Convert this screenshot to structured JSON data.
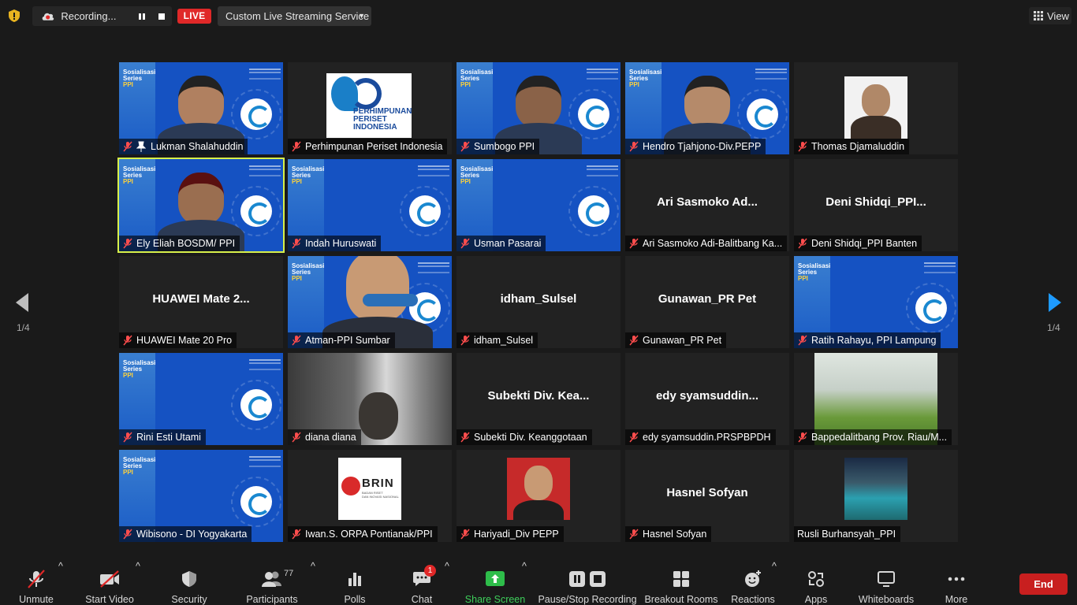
{
  "topbar": {
    "recording_label": "Recording...",
    "live_label": "LIVE",
    "stream_service": "Custom Live Streaming Service",
    "view_label": "View"
  },
  "pagination": {
    "left": "1/4",
    "right": "1/4"
  },
  "slide": {
    "line1": "Sosialisasi",
    "line2": "Series",
    "line3": "PPI"
  },
  "tiles": [
    {
      "label": "Lukman Shalahuddin",
      "big": ""
    },
    {
      "label": "Perhimpunan Periset Indonesia",
      "big": ""
    },
    {
      "label": "Sumbogo PPI",
      "big": ""
    },
    {
      "label": "Hendro Tjahjono-Div.PEPP",
      "big": ""
    },
    {
      "label": "Thomas Djamaluddin",
      "big": ""
    },
    {
      "label": "Ely Eliah BOSDM/ PPI",
      "big": ""
    },
    {
      "label": "Indah Huruswati",
      "big": ""
    },
    {
      "label": "Usman Pasarai",
      "big": ""
    },
    {
      "label": "Ari Sasmoko Adi-Balitbang Ka...",
      "big": "Ari Sasmoko Ad..."
    },
    {
      "label": "Deni Shidqi_PPI Banten",
      "big": "Deni  Shidqi_PPI..."
    },
    {
      "label": "HUAWEI Mate 20 Pro",
      "big": "HUAWEI Mate 2..."
    },
    {
      "label": "Atman-PPI Sumbar",
      "big": ""
    },
    {
      "label": "idham_Sulsel",
      "big": "idham_Sulsel"
    },
    {
      "label": "Gunawan_PR Pet",
      "big": "Gunawan_PR Pet"
    },
    {
      "label": "Ratih Rahayu, PPI Lampung",
      "big": ""
    },
    {
      "label": "Rini Esti Utami",
      "big": ""
    },
    {
      "label": "diana diana",
      "big": ""
    },
    {
      "label": "Subekti Div. Keanggotaan",
      "big": "Subekti  Div.  Kea..."
    },
    {
      "label": "edy syamsuddin.PRSPBPDH",
      "big": "edy  syamsuddin..."
    },
    {
      "label": "Bappedalitbang Prov. Riau/M...",
      "big": ""
    },
    {
      "label": "Wibisono - DI Yogyakarta",
      "big": ""
    },
    {
      "label": "Iwan.S. ORPA Pontianak/PPI",
      "big": ""
    },
    {
      "label": "Hariyadi_Div PEPP",
      "big": ""
    },
    {
      "label": "Hasnel Sofyan",
      "big": "Hasnel Sofyan"
    },
    {
      "label": "Rusli Burhansyah_PPI",
      "big": ""
    }
  ],
  "logo": {
    "ppi_line1": "PERHIMPUNAN",
    "ppi_line2": "PERISET",
    "ppi_line3": "INDONESIA",
    "brin": "BRIN",
    "brin_sub1": "BADAN RISET",
    "brin_sub2": "DAN INOVASI NASIONAL"
  },
  "toolbar": {
    "unmute": "Unmute",
    "start_video": "Start Video",
    "security": "Security",
    "participants": "Participants",
    "participants_count": "77",
    "polls": "Polls",
    "chat": "Chat",
    "chat_badge": "1",
    "share_screen": "Share Screen",
    "pause_recording": "Pause/Stop Recording",
    "breakout": "Breakout Rooms",
    "reactions": "Reactions",
    "apps": "Apps",
    "whiteboards": "Whiteboards",
    "more": "More",
    "end": "End"
  },
  "colors": {
    "live": "#e02828",
    "share_green": "#3ecf5b",
    "active_speaker": "#d7f04a",
    "end": "#c81f1f",
    "slide_blue": "#1552c2"
  }
}
